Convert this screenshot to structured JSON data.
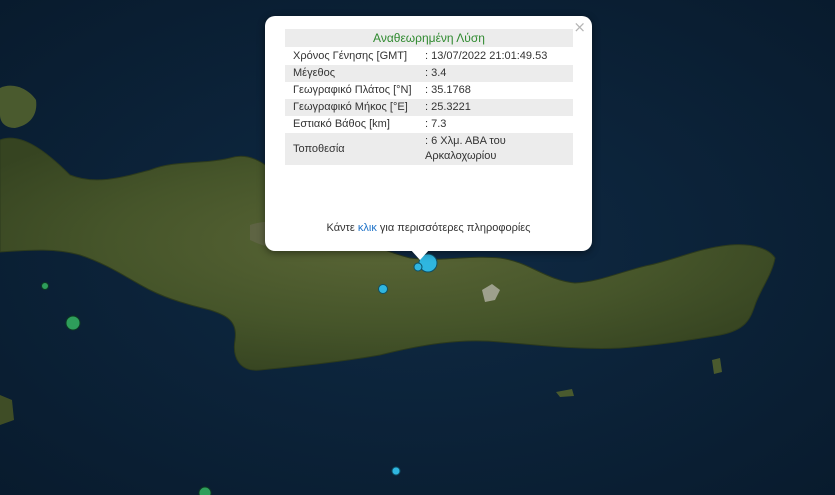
{
  "map": {
    "sea_color": "#0b2338",
    "land_color": "#4a5a2e",
    "markers": [
      {
        "name": "quake-marker-main",
        "color": "#2fb6e0"
      },
      {
        "name": "quake-marker-small",
        "color": "#2fb6e0"
      },
      {
        "name": "quake-marker-green-large",
        "color": "#2e9e5b"
      },
      {
        "name": "quake-marker-green-small",
        "color": "#2e9e5b"
      },
      {
        "name": "quake-marker-south",
        "color": "#2fb6e0"
      },
      {
        "name": "quake-marker-bottom",
        "color": "#2e9e5b"
      }
    ]
  },
  "popup": {
    "title": "Αναθεωρημένη Λύση",
    "title_color": "#2f8a2f",
    "close_label": "×",
    "rows": [
      {
        "label": "Χρόνος Γένησης [GMT]",
        "value": ": 13/07/2022 21:01:49.53"
      },
      {
        "label": "Μέγεθος",
        "value": ": 3.4"
      },
      {
        "label": "Γεωγραφικό Πλάτος [°N]",
        "value": ": 35.1768"
      },
      {
        "label": "Γεωγραφικό Μήκος [°E]",
        "value": ": 25.3221"
      },
      {
        "label": "Εστιακό Βάθος [km]",
        "value": ": 7.3"
      },
      {
        "label": "Τοποθεσία",
        "value": ": 6 Χλμ. ΑΒΑ του Αρκαλοχωρίου"
      }
    ],
    "more_prefix": "Κάντε ",
    "more_link": "κλικ",
    "more_suffix": " για περισσότερες πληροφορίες",
    "link_color": "#1e72c8"
  }
}
